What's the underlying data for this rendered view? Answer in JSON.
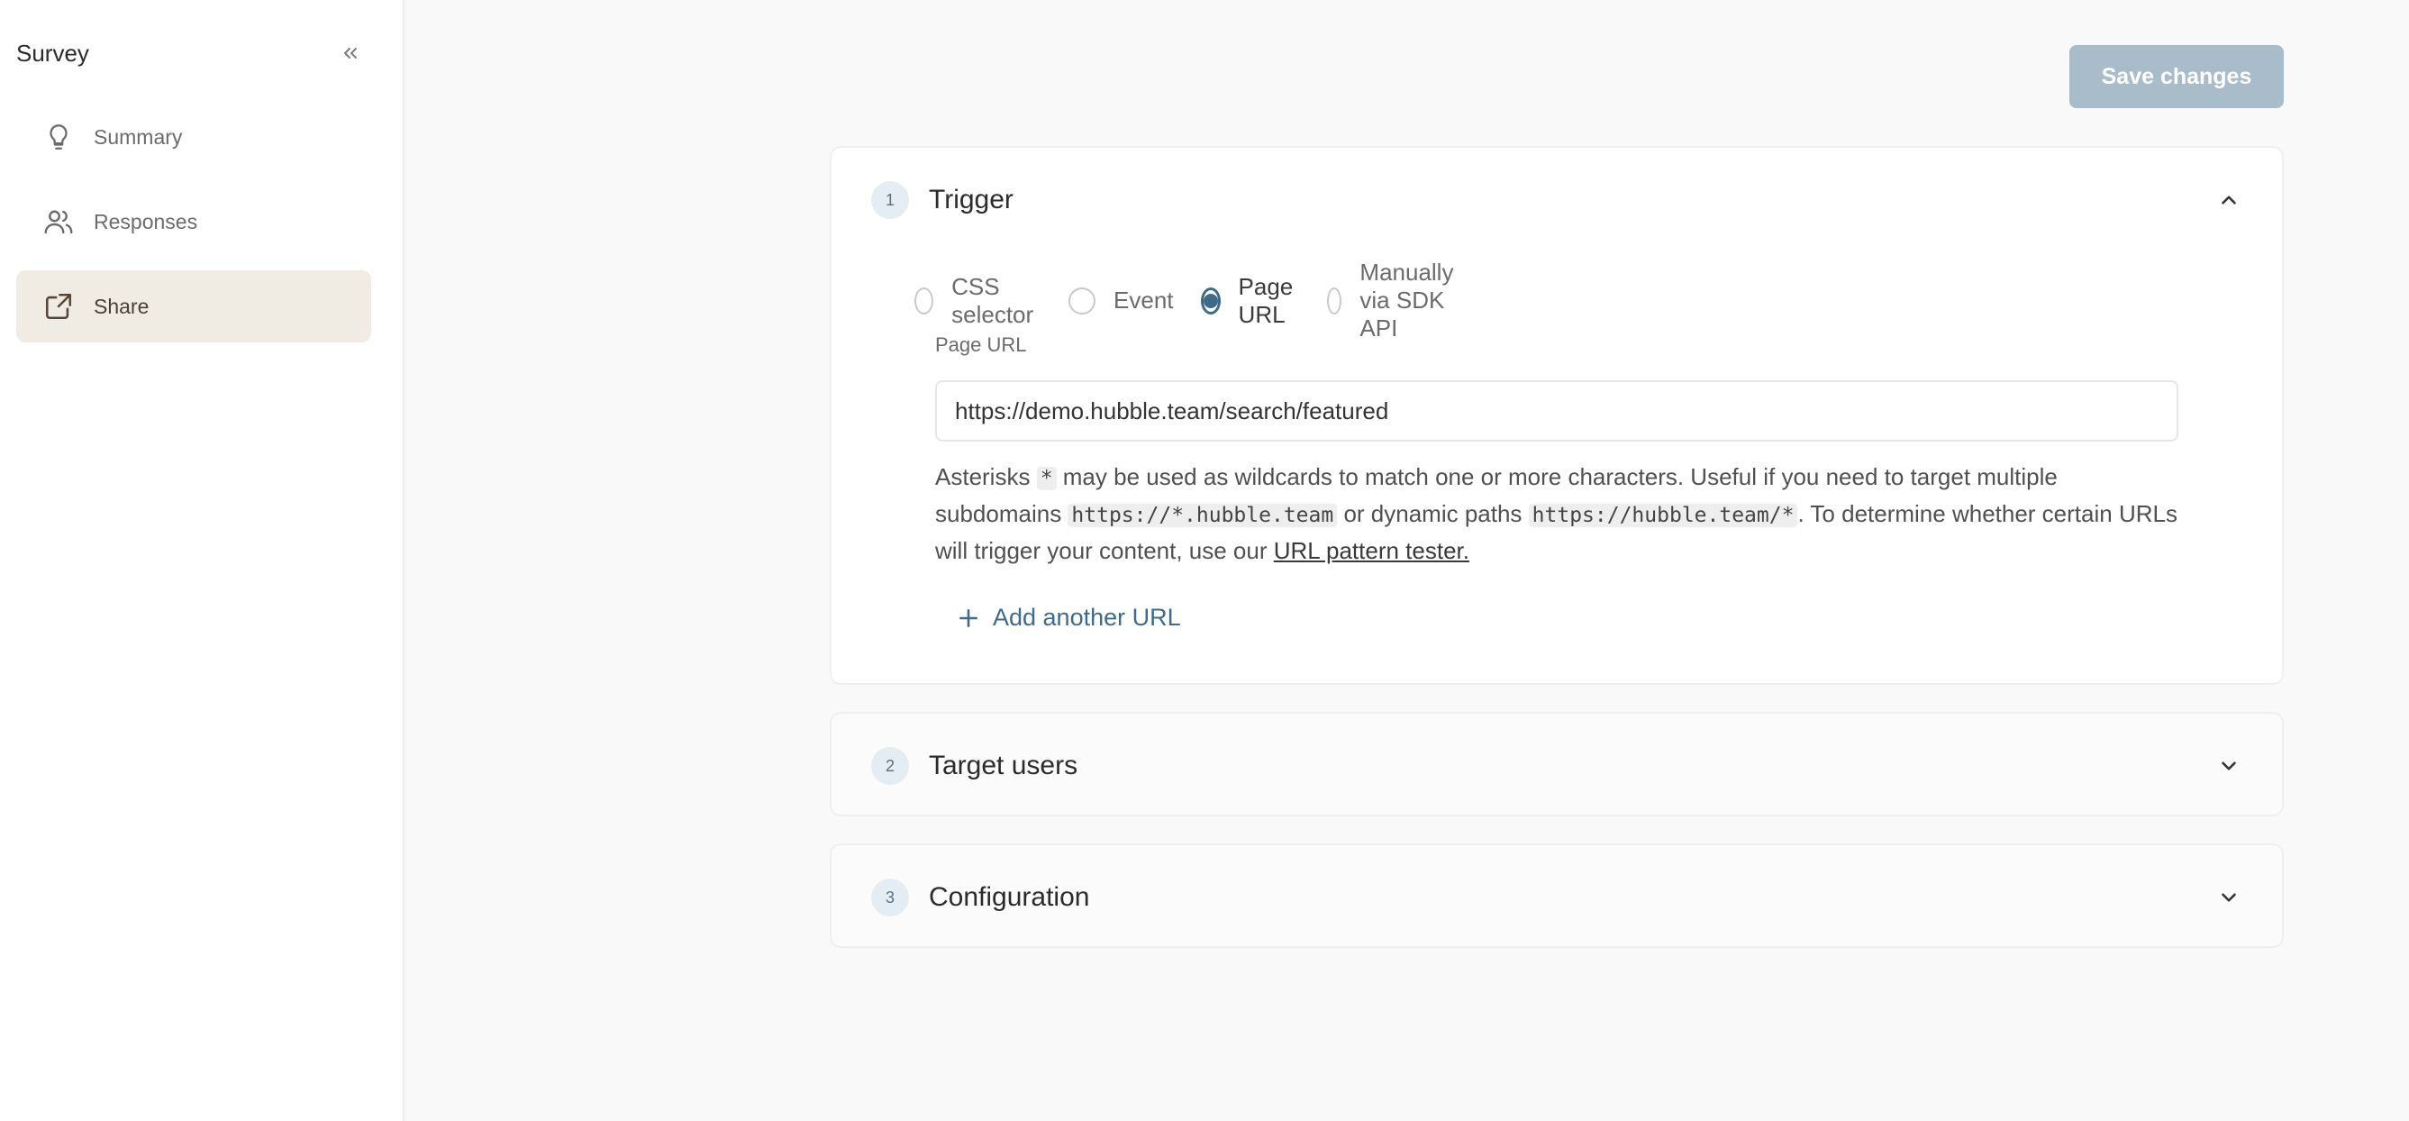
{
  "sidebar": {
    "title": "Survey",
    "collapse_icon": "double-chevron-left-icon",
    "items": [
      {
        "label": "Summary",
        "icon": "lightbulb-icon",
        "active": false
      },
      {
        "label": "Responses",
        "icon": "users-icon",
        "active": false
      },
      {
        "label": "Share",
        "icon": "external-link-icon",
        "active": true
      }
    ]
  },
  "toolbar": {
    "save_label": "Save changes"
  },
  "sections": [
    {
      "step": "1",
      "title": "Trigger",
      "expanded": true
    },
    {
      "step": "2",
      "title": "Target users",
      "expanded": false
    },
    {
      "step": "3",
      "title": "Configuration",
      "expanded": false
    }
  ],
  "trigger": {
    "options": [
      {
        "label": "CSS selector",
        "checked": false
      },
      {
        "label": "Event",
        "checked": false
      },
      {
        "label": "Page URL",
        "checked": true
      },
      {
        "label": "Manually via SDK API",
        "checked": false
      }
    ],
    "page_url_label": "Page URL",
    "page_url_value": "https://demo.hubble.team/search/featured",
    "help": {
      "t1": "Asterisks ",
      "code1": "*",
      "t2": " may be used as wildcards to match one or more characters. Useful if you need to target multiple subdomains ",
      "code2": "https://*.hubble.team",
      "t3": " or dynamic paths ",
      "code3": "https://hubble.team/*",
      "t4": ". To determine whether certain URLs will trigger your content, use our ",
      "link": "URL pattern tester."
    },
    "add_url_label": "Add another URL"
  },
  "colors": {
    "accent": "#3f6a8a",
    "save_button": "#a9bcca",
    "active_nav": "#f0ece4"
  }
}
